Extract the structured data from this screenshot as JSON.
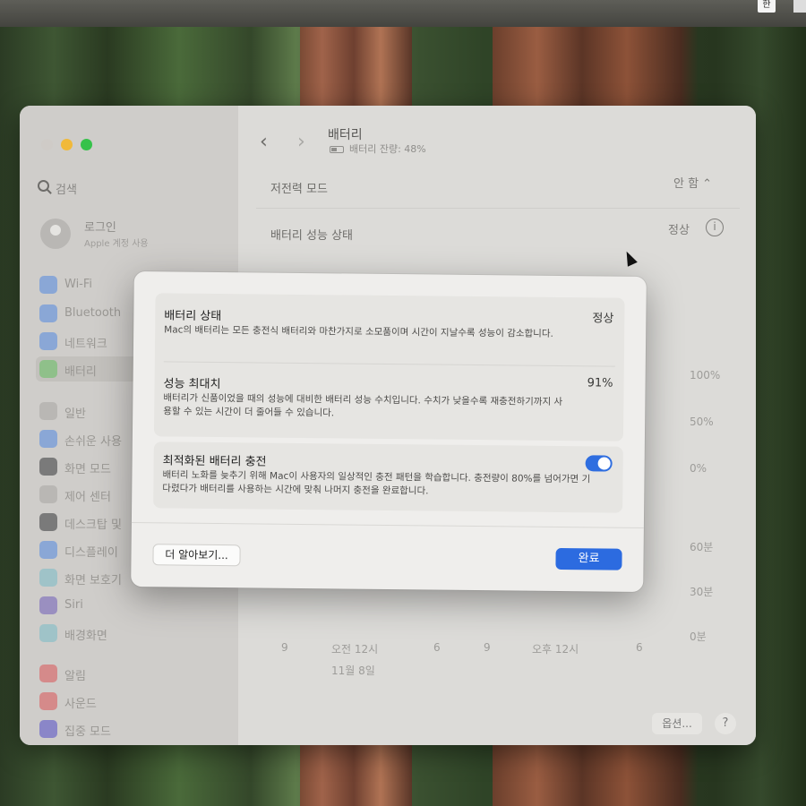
{
  "menubar": {
    "input_source": "한"
  },
  "sidebar": {
    "search_placeholder": "검색",
    "account": {
      "name": "로그인",
      "subtitle": "Apple 계정 사용"
    },
    "items": [
      {
        "label": "Wi-Fi",
        "color": "#8aa7d6"
      },
      {
        "label": "Bluetooth",
        "color": "#8aa7d6"
      },
      {
        "label": "네트워크",
        "color": "#8aa7d6"
      },
      {
        "label": "배터리",
        "color": "#8fc08a"
      },
      {
        "label": "일반",
        "color": "#b9b7b4"
      },
      {
        "label": "손쉬운 사용",
        "color": "#8aa7d6"
      },
      {
        "label": "화면 모드",
        "color": "#7a7a7a"
      },
      {
        "label": "제어 센터",
        "color": "#b9b7b4"
      },
      {
        "label": "데스크탑 및",
        "color": "#7a7a7a"
      },
      {
        "label": "디스플레이",
        "color": "#8aa7d6"
      },
      {
        "label": "화면 보호기",
        "color": "#9fc3c8"
      },
      {
        "label": "Siri",
        "color": "#9a8fc0"
      },
      {
        "label": "배경화면",
        "color": "#9fc3c8"
      },
      {
        "label": "알림",
        "color": "#d58a8a"
      },
      {
        "label": "사운드",
        "color": "#d58a8a"
      },
      {
        "label": "집중 모드",
        "color": "#8a86c8"
      }
    ]
  },
  "content": {
    "title": "배터리",
    "battery_level": "배터리 잔량: 48%",
    "low_power": {
      "label": "저전력 모드",
      "value": "안 함 ⌃"
    },
    "health": {
      "label": "배터리 성능 상태",
      "value": "정상"
    },
    "chart_axis": {
      "percent": [
        "100%",
        "50%",
        "0%"
      ],
      "minutes": [
        "60분",
        "30분",
        "0분"
      ],
      "time_ticks": [
        "9",
        "오전 12시",
        "6",
        "9",
        "오후 12시",
        "6"
      ],
      "date": "11월 8일"
    },
    "options_label": "옵션...",
    "help_label": "?"
  },
  "modal": {
    "status": {
      "title": "배터리 상태",
      "value": "정상",
      "desc": "Mac의 배터리는 모든 충전식 배터리와 마찬가지로 소모품이며 시간이 지날수록 성능이 감소합니다."
    },
    "max_capacity": {
      "title": "성능 최대치",
      "value": "91%",
      "desc": "배터리가 신품이었을 때의 성능에 대비한 배터리 성능 수치입니다. 수치가 낮을수록 재충전하기까지 사용할 수 있는 시간이 더 줄어들 수 있습니다."
    },
    "optimized": {
      "title": "최적화된 배터리 충전",
      "enabled": true,
      "desc": "배터리 노화를 늦추기 위해 Mac이 사용자의 일상적인 충전 패턴을 학습합니다. 충전량이 80%를 넘어가면 기다렸다가 배터리를 사용하는 시간에 맞춰 나머지 충전을 완료합니다."
    },
    "learn_more": "더 알아보기...",
    "done": "완료"
  }
}
